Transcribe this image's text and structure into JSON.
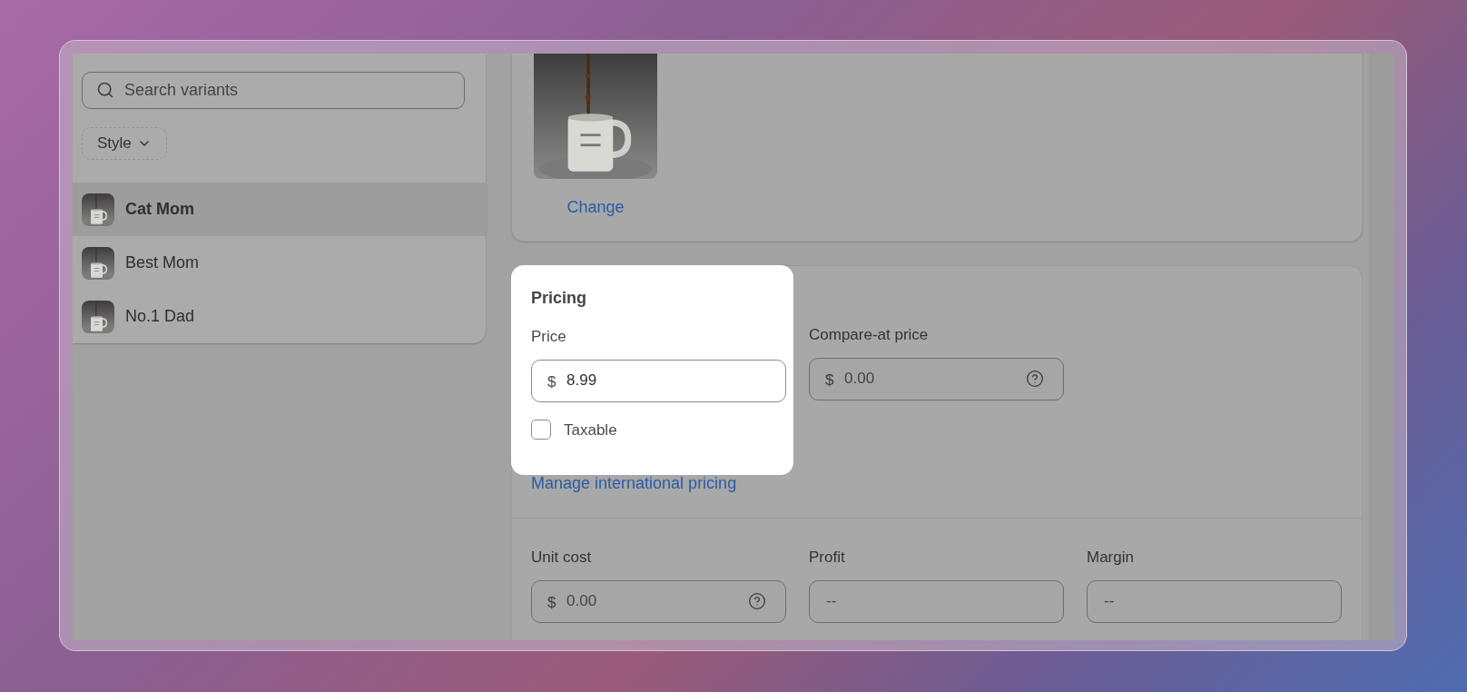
{
  "variants_panel": {
    "search": {
      "placeholder": "Search variants"
    },
    "filter": {
      "label": "Style"
    },
    "variants": [
      {
        "name": "Cat Mom",
        "selected": true
      },
      {
        "name": "Best Mom",
        "selected": false
      },
      {
        "name": "No.1 Dad",
        "selected": false
      }
    ]
  },
  "image_card": {
    "change_link": "Change"
  },
  "pricing": {
    "title": "Pricing",
    "price": {
      "label": "Price",
      "currency": "$",
      "value": "8.99"
    },
    "compare_at": {
      "label": "Compare-at price",
      "currency": "$",
      "placeholder": "0.00"
    },
    "taxable": {
      "label": "Taxable",
      "checked": false
    },
    "international_link": "Manage international pricing",
    "unit_cost": {
      "label": "Unit cost",
      "currency": "$",
      "placeholder": "0.00"
    },
    "profit": {
      "label": "Profit",
      "placeholder": "--"
    },
    "margin": {
      "label": "Margin",
      "placeholder": "--"
    }
  }
}
